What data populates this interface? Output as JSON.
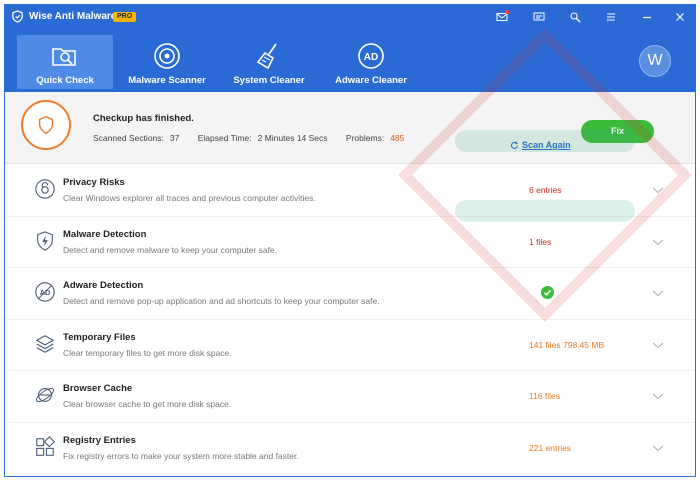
{
  "window": {
    "app_title": "Wise Anti Malware",
    "badge": "PRO",
    "titlebar_icons": [
      "mail-icon",
      "message-icon",
      "tools-icon",
      "menu-icon",
      "minimize-icon",
      "close-icon"
    ]
  },
  "nav": {
    "tabs": [
      {
        "label": "Quick Check",
        "icon": "folder-search-icon",
        "active": true
      },
      {
        "label": "Malware Scanner",
        "icon": "target-icon",
        "active": false
      },
      {
        "label": "System Cleaner",
        "icon": "broom-icon",
        "active": false
      },
      {
        "label": "Adware Cleaner",
        "icon": "ad-icon",
        "active": false
      }
    ],
    "avatar_letter": "W"
  },
  "status": {
    "title": "Checkup has finished.",
    "scanned_label": "Scanned Sections:",
    "scanned_value": "37",
    "elapsed_label": "Elapsed Time:",
    "elapsed_value": "2 Minutes 14 Secs",
    "problems_label": "Problems:",
    "problems_value": "485",
    "scan_again": "Scan Again",
    "fix": "Fix"
  },
  "items": [
    {
      "title": "Privacy Risks",
      "desc": "Clear Windows explorer all traces and previous computer activities.",
      "value": "6 entries",
      "tone": "red",
      "icon": "privacy-icon"
    },
    {
      "title": "Malware Detection",
      "desc": "Detect and remove malware to keep your computer safe.",
      "value": "1 files",
      "tone": "red",
      "icon": "shield-bolt-icon"
    },
    {
      "title": "Adware Detection",
      "desc": "Detect and remove pop-up application and ad shortcuts to keep your computer safe.",
      "value": "",
      "tone": "ok",
      "icon": "ad-icon"
    },
    {
      "title": "Temporary Files",
      "desc": "Clear temporary files to get more disk space.",
      "value": "141 files 798.45 MB",
      "tone": "orange",
      "icon": "layers-icon"
    },
    {
      "title": "Browser Cache",
      "desc": "Clear browser cache to get more disk space.",
      "value": "116 files",
      "tone": "orange",
      "icon": "browser-icon"
    },
    {
      "title": "Registry Entries",
      "desc": "Fix registry errors to make your system more stable and faster.",
      "value": "221 entries",
      "tone": "orange",
      "icon": "registry-icon"
    }
  ],
  "colors": {
    "header_blue": "#2a6ad5",
    "active_tab": "#4f8be6",
    "accent_orange": "#ee7d2b",
    "fix_green": "#3dbb3d",
    "danger_red": "#d0281b"
  }
}
